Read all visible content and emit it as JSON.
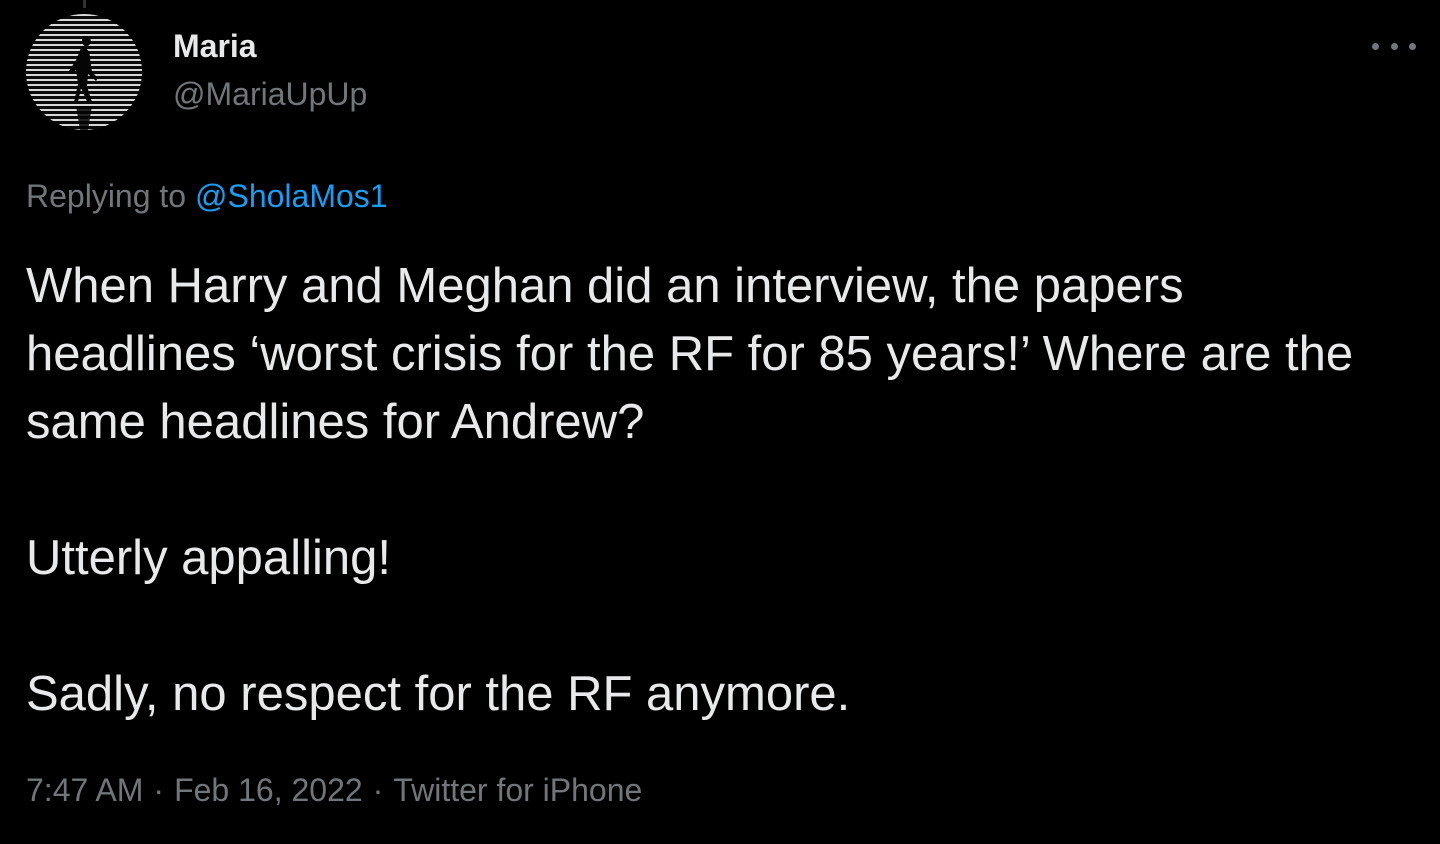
{
  "author": {
    "display_name": "Maria",
    "handle": "@MariaUpUp"
  },
  "reply": {
    "prefix": "Replying to",
    "to_handle": "@SholaMos1"
  },
  "tweet": {
    "paragraphs": [
      "When Harry and Meghan did an interview, the papers headlines ‘worst crisis for the RF for 85 years!’ Where are the same headlines for Andrew?",
      "Utterly appalling!",
      "Sadly, no respect for the RF anymore."
    ]
  },
  "meta": {
    "time": "7:47 AM",
    "date": "Feb 16, 2022",
    "source": "Twitter for iPhone",
    "separator": "·"
  },
  "icons": {
    "more": "more-horizontal-icon"
  },
  "colors": {
    "background": "#000000",
    "primary_text": "#e7e9ea",
    "secondary_text": "#71767b",
    "link": "#1d9bf0"
  }
}
